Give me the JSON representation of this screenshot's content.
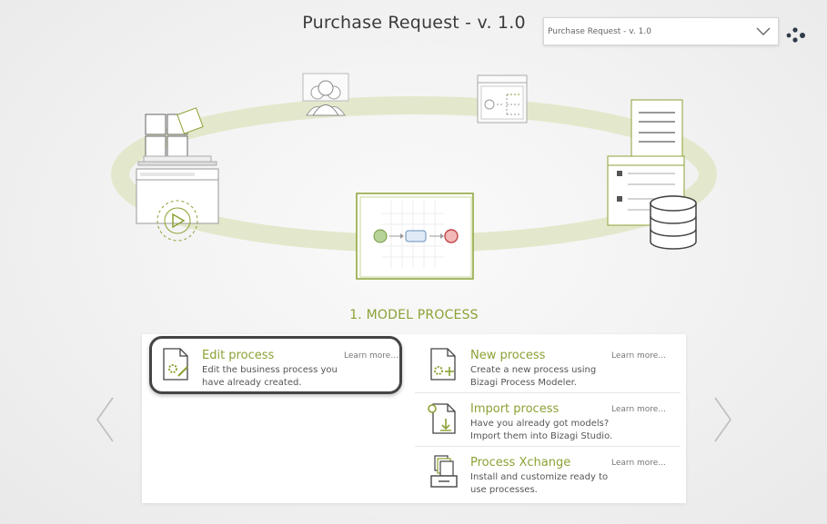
{
  "header": {
    "title": "Purchase Request - v. 1.0",
    "version_select_value": "Purchase Request - v. 1.0"
  },
  "icons": {
    "version_dropdown": "chevron-down-icon",
    "menu": "dots-menu-icon",
    "prev": "chevron-left-icon",
    "next": "chevron-right-icon"
  },
  "step": {
    "title": "1. MODEL PROCESS"
  },
  "options": [
    {
      "title": "Edit process",
      "description": "Edit the business process you have already created.",
      "learn_more": "Learn more...",
      "icon": "edit-process-icon"
    },
    {
      "title": "New process",
      "description": "Create a new process using Bizagi Process Modeler.",
      "learn_more": "Learn more...",
      "icon": "new-process-icon"
    },
    {
      "title": "Import process",
      "description": "Have you already got models? Import them into Bizagi Studio.",
      "learn_more": "Learn more...",
      "icon": "import-process-icon"
    },
    {
      "title": "Process Xchange",
      "description": "Install and customize ready to use processes.",
      "learn_more": "Learn more...",
      "icon": "process-xchange-icon"
    }
  ],
  "colors": {
    "accent_green": "#8aa234",
    "ring_green": "#e3e8cc",
    "text_dark": "#3b3b3b"
  }
}
